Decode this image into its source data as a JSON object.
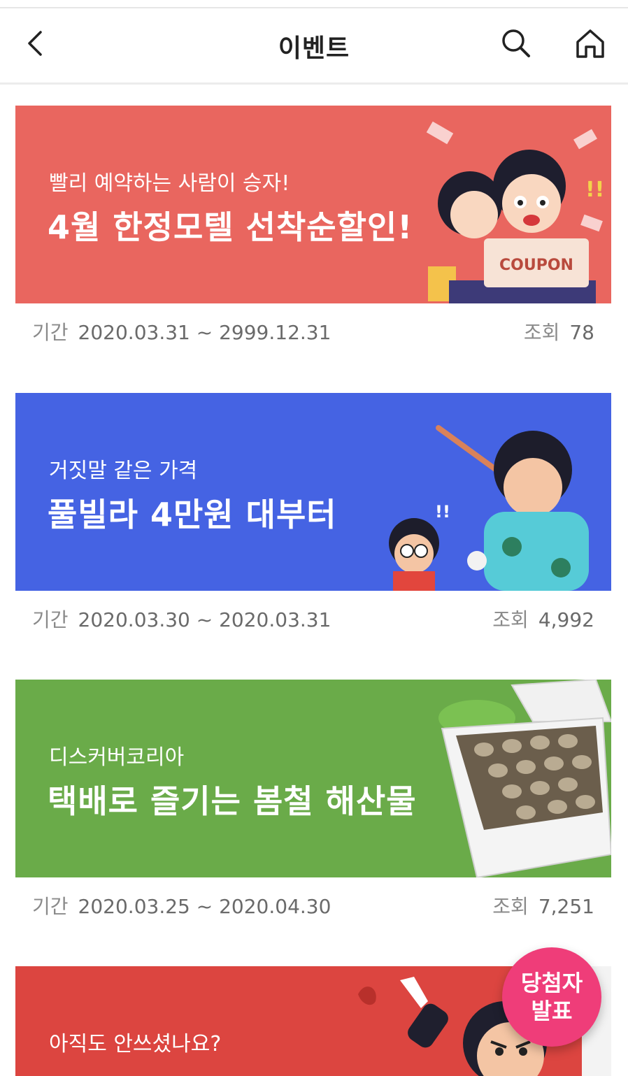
{
  "header": {
    "title": "이벤트"
  },
  "events": [
    {
      "subtitle": "빨리 예약하는 사람이 승자!",
      "headline": "4월 한정모텔 선착순할인!",
      "badge": "COUPON",
      "period_label": "기간",
      "period": "2020.03.31 ~ 2999.12.31",
      "views_label": "조회",
      "views": "78",
      "color": "#e9665f"
    },
    {
      "subtitle": "거짓말 같은 가격",
      "headline": "풀빌라 4만원 대부터",
      "period_label": "기간",
      "period": "2020.03.30 ~ 2020.03.31",
      "views_label": "조회",
      "views": "4,992",
      "color": "#4563e3"
    },
    {
      "subtitle": "디스커버코리아",
      "headline": "택배로 즐기는 봄철 해산물",
      "period_label": "기간",
      "period": "2020.03.25 ~ 2020.04.30",
      "views_label": "조회",
      "views": "7,251",
      "color": "#6aab49"
    },
    {
      "subtitle": "아직도 안쓰셨나요?",
      "color": "#dc4540"
    }
  ],
  "fab": {
    "line1": "당첨자",
    "line2": "발표",
    "color": "#ef3d79"
  }
}
